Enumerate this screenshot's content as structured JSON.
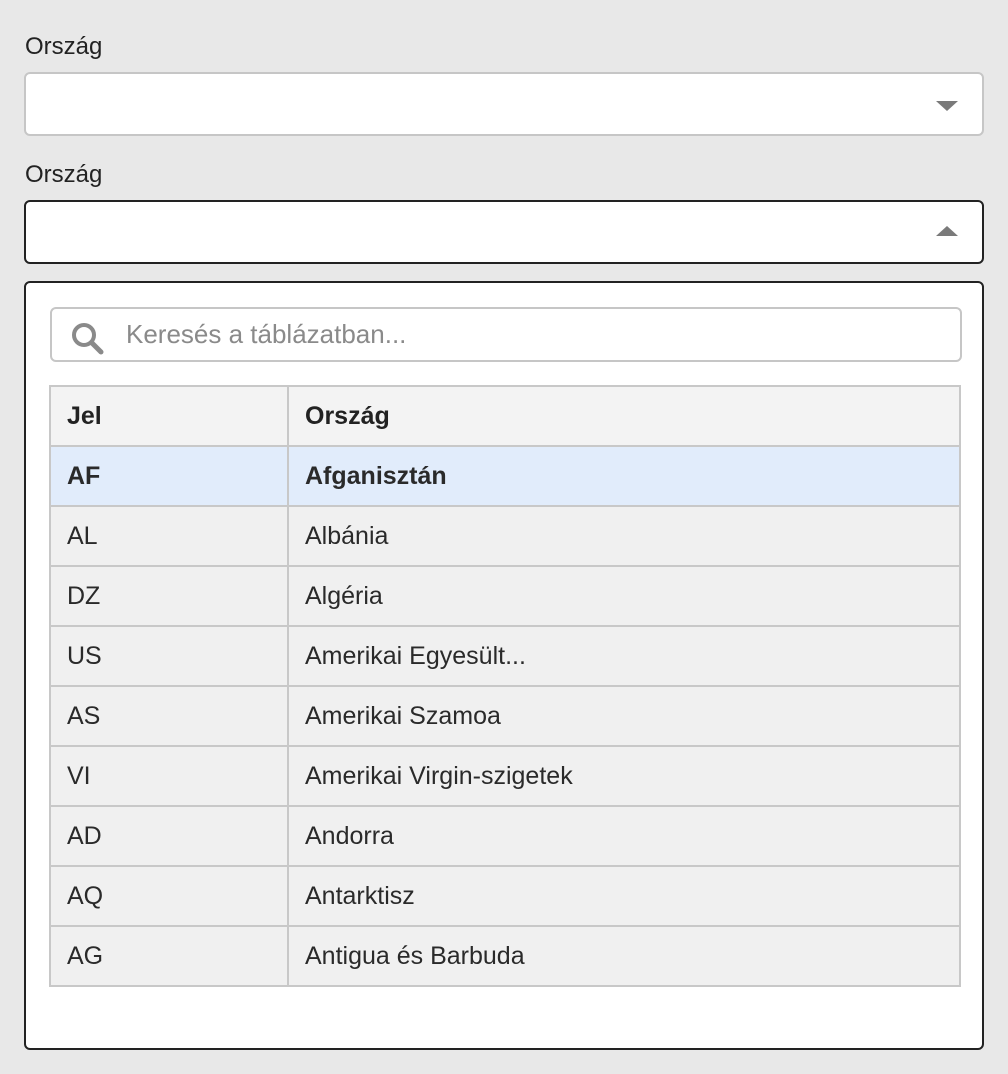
{
  "field1": {
    "label": "Ország",
    "value": ""
  },
  "field2": {
    "label": "Ország",
    "value": ""
  },
  "dropdown": {
    "search_placeholder": "Keresés a táblázatban...",
    "columns": [
      "Jel",
      "Ország"
    ],
    "rows": [
      {
        "code": "AF",
        "name": "Afganisztán",
        "selected": true
      },
      {
        "code": "AL",
        "name": "Albánia"
      },
      {
        "code": "DZ",
        "name": "Algéria"
      },
      {
        "code": "US",
        "name": "Amerikai Egyesült..."
      },
      {
        "code": "AS",
        "name": "Amerikai Szamoa"
      },
      {
        "code": "VI",
        "name": "Amerikai Virgin-szigetek"
      },
      {
        "code": "AD",
        "name": "Andorra"
      },
      {
        "code": "AQ",
        "name": "Antarktisz"
      },
      {
        "code": "AG",
        "name": "Antigua és Barbuda"
      }
    ]
  },
  "colors": {
    "selected_row": "#e1ecfb",
    "border_active": "#222222",
    "border_idle": "#c6c6c6"
  }
}
